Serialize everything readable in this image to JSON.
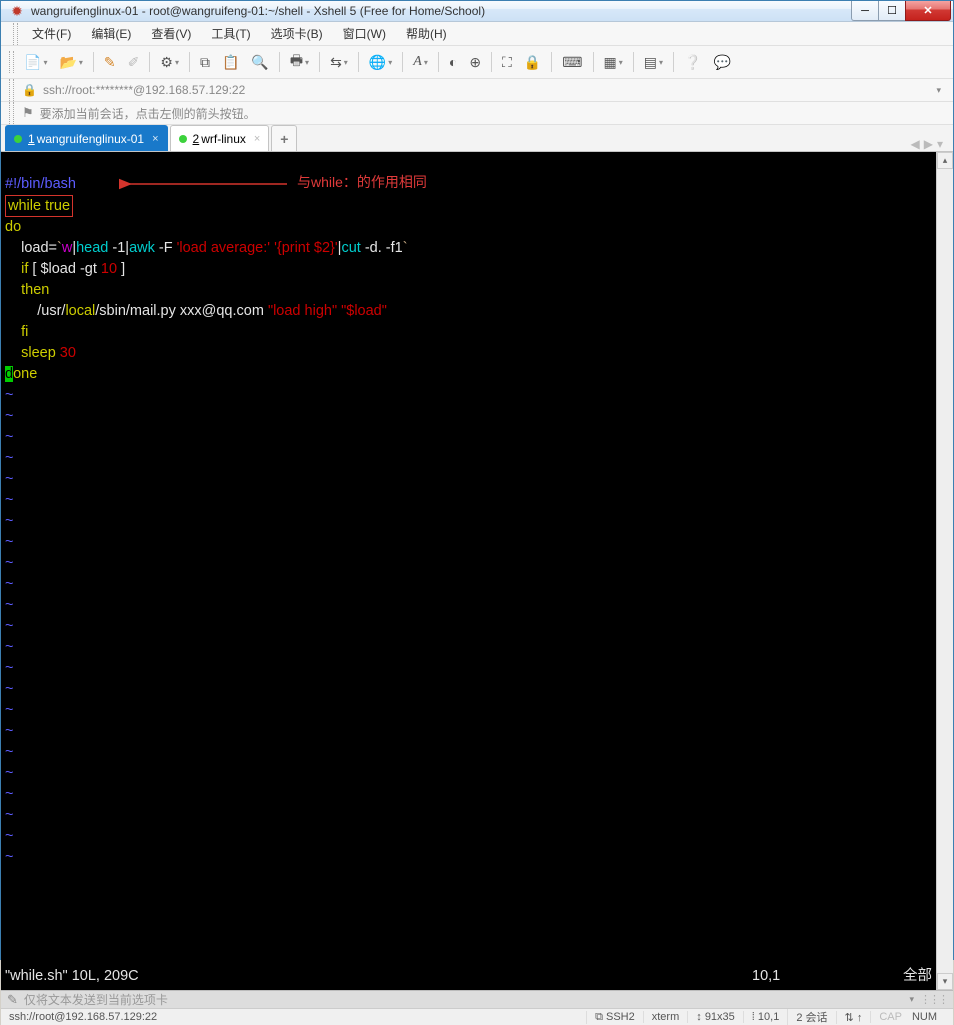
{
  "window": {
    "title": "wangruifenglinux-01 - root@wangruifeng-01:~/shell - Xshell 5 (Free for Home/School)"
  },
  "menubar": {
    "items": [
      "文件(F)",
      "编辑(E)",
      "查看(V)",
      "工具(T)",
      "选项卡(B)",
      "窗口(W)",
      "帮助(H)"
    ]
  },
  "addressbar": {
    "text": "ssh://root:********@192.168.57.129:22"
  },
  "hintbar": {
    "text": "要添加当前会话，点击左侧的箭头按钮。"
  },
  "tabs": {
    "items": [
      {
        "num": "1",
        "label": "wangruifenglinux-01",
        "active": true
      },
      {
        "num": "2",
        "label": "wrf-linux",
        "active": false
      }
    ]
  },
  "terminal": {
    "annotation": "与while：的作用相同",
    "lines": {
      "l1_shebang": "#!/bin/bash",
      "l2_while": "while",
      "l2_true": " true",
      "l3_do": "do",
      "l4_pre": "    load=",
      "l4_bt1": "`",
      "l4_w": "w",
      "l4_p1": "|",
      "l4_head": "head",
      "l4_opt1": " -1",
      "l4_p2": "|",
      "l4_awk": "awk",
      "l4_F": " -F ",
      "l4_str1": "'load average:'",
      "l4_sp": " ",
      "l4_str2": "'{print $2}'",
      "l4_p3": "|",
      "l4_cut": "cut",
      "l4_opt2": " -d. -f1",
      "l4_bt2": "`",
      "l5_if": "    if",
      "l5_test": " [ $load -gt ",
      "l5_num": "10",
      "l5_end": " ]",
      "l6_then": "    then",
      "l7_pre": "        /usr/",
      "l7_local": "local",
      "l7_mid": "/sbin/mail.py xxx@qq.com ",
      "l7_s1": "\"load high\"",
      "l7_sp": " ",
      "l7_s2": "\"$load\"",
      "l8_fi": "    fi",
      "l9_sleep": "    sleep",
      "l9_num": " 30",
      "l10_d": "d",
      "l10_one": "one"
    },
    "status": {
      "left": "\"while.sh\" 10L, 209C",
      "pos": "10,1",
      "right": "全部"
    }
  },
  "bottominput": {
    "placeholder": "仅将文本发送到当前选项卡"
  },
  "statusbar": {
    "conn": "ssh://root@192.168.57.129:22",
    "proto": "SSH2",
    "term": "xterm",
    "size": "91x35",
    "cursor": "10,1",
    "sessions": "2 会话",
    "cap": "CAP",
    "num": "NUM",
    "proto_icon": "⧉",
    "size_icon": "↕",
    "cursor_icon": "⁞",
    "sessions_icon": "⇅",
    "net_icon": "↑"
  }
}
